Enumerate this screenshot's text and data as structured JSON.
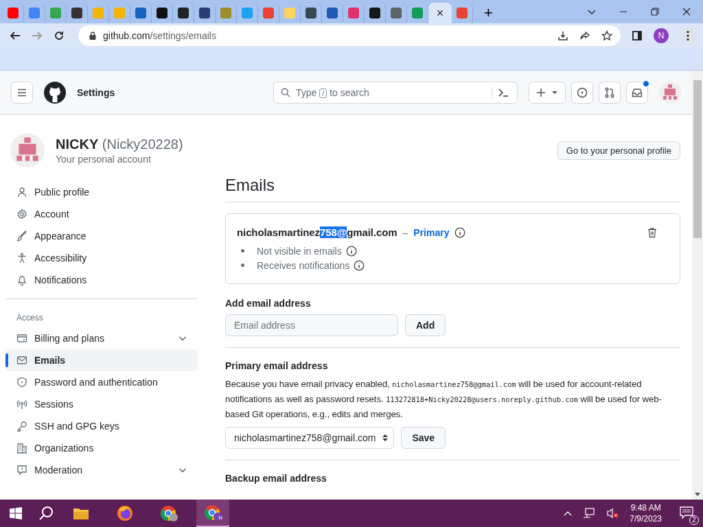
{
  "browser": {
    "tabs": [
      {
        "color": "#ff0000",
        "selected": false
      },
      {
        "color": "#4285f4",
        "selected": false
      },
      {
        "color": "#34a853",
        "selected": false
      },
      {
        "color": "#333333",
        "selected": false
      },
      {
        "color": "#f4b400",
        "selected": false
      },
      {
        "color": "#f4b400",
        "selected": false
      },
      {
        "color": "#1565c0",
        "selected": false
      },
      {
        "color": "#111111",
        "selected": false
      },
      {
        "color": "#222222",
        "selected": false
      },
      {
        "color": "#2c3e7a",
        "selected": false
      },
      {
        "color": "#a08c2a",
        "selected": false
      },
      {
        "color": "#1da1f2",
        "selected": false
      },
      {
        "color": "#ea4335",
        "selected": false
      },
      {
        "color": "#f9d55b",
        "selected": false
      },
      {
        "color": "#37474f",
        "selected": false
      },
      {
        "color": "#1e5bb5",
        "selected": false
      },
      {
        "color": "#e1306c",
        "selected": false
      },
      {
        "color": "#181717",
        "selected": false
      },
      {
        "color": "#5f6368",
        "selected": false
      },
      {
        "color": "#0f9d58",
        "selected": false
      },
      {
        "selected": true
      },
      {
        "color": "#ea4335",
        "selected": false
      }
    ],
    "close_glyph": "×",
    "new_tab": "+",
    "url_host": "github.com",
    "url_path": "/settings/emails",
    "profile_initial": "N"
  },
  "header": {
    "title": "Settings",
    "search": {
      "before": "Type",
      "key": "/",
      "after": "to search"
    },
    "notification_dot": true
  },
  "account": {
    "name": "NICKY",
    "login": "(Nicky20228)",
    "subtitle": "Your personal account",
    "profile_button": "Go to your personal profile"
  },
  "sidebar": {
    "sections": [
      {
        "items": [
          {
            "label": "Public profile",
            "selected": false,
            "expandable": false
          },
          {
            "label": "Account",
            "selected": false,
            "expandable": false
          },
          {
            "label": "Appearance",
            "selected": false,
            "expandable": false
          },
          {
            "label": "Accessibility",
            "selected": false,
            "expandable": false
          },
          {
            "label": "Notifications",
            "selected": false,
            "expandable": false
          }
        ]
      },
      {
        "heading": "Access",
        "items": [
          {
            "label": "Billing and plans",
            "selected": false,
            "expandable": true
          },
          {
            "label": "Emails",
            "selected": true,
            "expandable": false
          },
          {
            "label": "Password and authentication",
            "selected": false,
            "expandable": false
          },
          {
            "label": "Sessions",
            "selected": false,
            "expandable": false
          },
          {
            "label": "SSH and GPG keys",
            "selected": false,
            "expandable": false
          },
          {
            "label": "Organizations",
            "selected": false,
            "expandable": false
          },
          {
            "label": "Moderation",
            "selected": false,
            "expandable": true
          }
        ]
      }
    ]
  },
  "emails": {
    "title": "Emails",
    "card": {
      "address_parts": [
        {
          "text": "nicholasmartinez",
          "selected": false
        },
        {
          "text": "758@",
          "selected": true
        },
        {
          "text": "gmail.com",
          "selected": false
        }
      ],
      "separator": "–",
      "badge": "Primary",
      "notes": [
        "Not visible in emails",
        "Receives notifications"
      ]
    },
    "add": {
      "label": "Add email address",
      "placeholder": "Email address",
      "button": "Add"
    },
    "primary": {
      "label": "Primary email address",
      "paragraph": [
        {
          "kind": "text",
          "text": "Because you have email privacy enabled, "
        },
        {
          "kind": "code",
          "text": "nicholasmartinez758@gmail.com"
        },
        {
          "kind": "text",
          "text": " will be used for account-related notifications as well as password resets. "
        },
        {
          "kind": "code",
          "text": "113272818+Nicky20228@users.noreply.github.com"
        },
        {
          "kind": "text",
          "text": " will be used for web-based Git operations, e.g., edits and merges."
        }
      ],
      "select_value": "nicholasmartinez758@gmail.com",
      "button": "Save"
    },
    "backup": {
      "label": "Backup email address"
    }
  },
  "taskbar": {
    "apps": [
      {
        "selected": false
      },
      {
        "selected": false
      },
      {
        "selected": false
      },
      {
        "selected": true
      }
    ],
    "active_initial": "N",
    "time": "9:48 AM",
    "date": "7/9/2023",
    "notification_count": "2"
  }
}
